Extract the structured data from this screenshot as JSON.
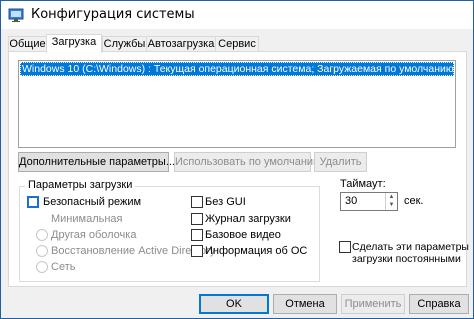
{
  "window": {
    "title": "Конфигурация системы"
  },
  "tabs": [
    {
      "label": "Общие"
    },
    {
      "label": "Загрузка"
    },
    {
      "label": "Службы"
    },
    {
      "label": "Автозагрузка"
    },
    {
      "label": "Сервис"
    }
  ],
  "active_tab": "Загрузка",
  "boot_list": {
    "entries": [
      "Windows 10 (C:\\Windows) : Текущая операционная система; Загружаемая по умолчанию ОС"
    ]
  },
  "list_buttons": {
    "advanced": "Дополнительные параметры...",
    "set_default": "Использовать по умолчанию",
    "delete": "Удалить"
  },
  "boot_options": {
    "group_title": "Параметры загрузки",
    "safe_mode": {
      "label": "Безопасный режим",
      "checked": false
    },
    "minimal": "Минимальная",
    "alt_shell": "Другая оболочка",
    "ad_repair": "Восстановление Active Directory",
    "network": "Сеть",
    "no_gui": {
      "label": "Без GUI",
      "checked": false
    },
    "boot_log": {
      "label": "Журнал загрузки",
      "checked": false
    },
    "base_video": {
      "label": "Базовое видео",
      "checked": false
    },
    "os_info": {
      "label": "Информация об ОС",
      "checked": false
    }
  },
  "timeout": {
    "label": "Таймаут:",
    "value": "30",
    "unit": "сек."
  },
  "make_permanent": {
    "label_line1": "Сделать эти параметры",
    "label_line2": "загрузки постоянными",
    "checked": false
  },
  "footer_buttons": {
    "ok": "OK",
    "cancel": "Отмена",
    "apply": "Применить",
    "help": "Справка"
  },
  "colors": {
    "selection": "#0078d7",
    "focus_border": "#1a6fd6"
  }
}
